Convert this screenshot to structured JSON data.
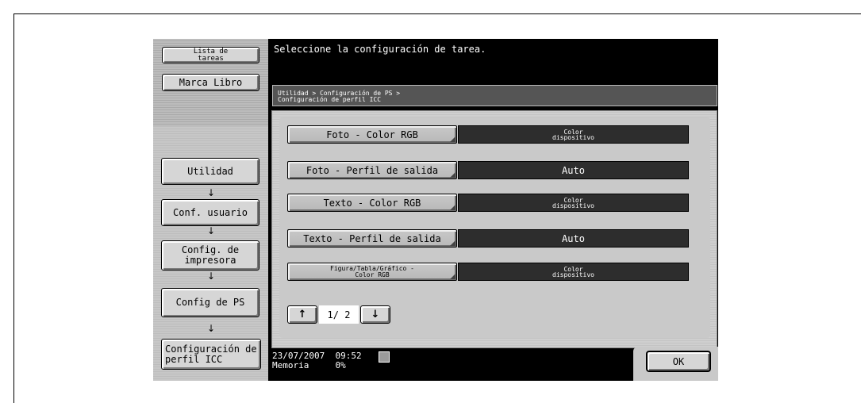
{
  "left_panel": {
    "task_list_label": "Lista de\ntareas",
    "bookmark_label": "Marca Libro",
    "nav": [
      {
        "label": "Utilidad"
      },
      {
        "label": "Conf. usuario"
      },
      {
        "label": "Config. de\nimpresora"
      },
      {
        "label": "Config de PS"
      },
      {
        "label": "Configuración de\nperfil ICC"
      }
    ]
  },
  "message": "Seleccione la configuración de tarea.",
  "breadcrumb": "Utilidad > Configuración de PS >\nConfiguración de perfil ICC",
  "settings": [
    {
      "label": "Foto - Color RGB",
      "value": "Color\ndispositivo"
    },
    {
      "label": "Foto - Perfil de salida",
      "value": "Auto"
    },
    {
      "label": "Texto - Color RGB",
      "value": "Color\ndispositivo"
    },
    {
      "label": "Texto - Perfil de salida",
      "value": "Auto"
    },
    {
      "label": "Figura/Tabla/Gráfico -\nColor RGB",
      "value": "Color\ndispositivo"
    }
  ],
  "pager": {
    "up": "↑",
    "down": "↓",
    "page": "1/ 2"
  },
  "status": {
    "date": "23/07/2007",
    "time": "09:52",
    "memory_label": "Memoria",
    "memory_value": "0%"
  },
  "ok_label": "OK",
  "arrow_glyph": "↓"
}
